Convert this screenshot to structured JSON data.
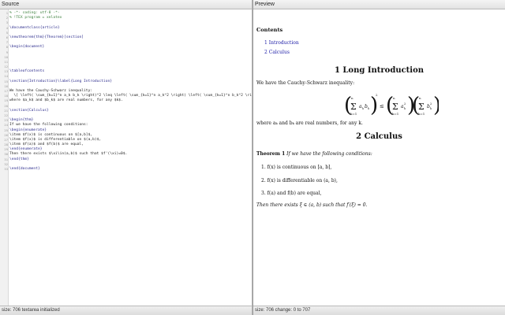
{
  "left": {
    "header": "Source",
    "status": "size: 706 textarea initialized",
    "lines": [
      {
        "n": "1",
        "text": "% -*- coding: utf-8 -*-",
        "cls": "comment"
      },
      {
        "n": "2",
        "text": "% !TEX program = xelatex",
        "cls": "comment"
      },
      {
        "n": "3",
        "text": "",
        "cls": "plain"
      },
      {
        "n": "4",
        "text": "\\documentclass{article}",
        "cls": "cmd"
      },
      {
        "n": "5",
        "text": "",
        "cls": "plain"
      },
      {
        "n": "6",
        "text": "\\newtheorem{thm}{Theorem}[section]",
        "cls": "cmd"
      },
      {
        "n": "7",
        "text": "",
        "cls": "plain"
      },
      {
        "n": "8",
        "text": "\\begin{document}",
        "cls": "cmd"
      },
      {
        "n": "9",
        "text": "",
        "cls": "plain"
      },
      {
        "n": "10",
        "text": "",
        "cls": "plain"
      },
      {
        "n": "11",
        "text": "",
        "cls": "plain"
      },
      {
        "n": "12",
        "text": "",
        "cls": "plain"
      },
      {
        "n": "13",
        "text": "\\tableofcontents",
        "cls": "cmd"
      },
      {
        "n": "14",
        "text": "",
        "cls": "plain"
      },
      {
        "n": "15",
        "text": "\\section{Introduction}\\label{Long Introduction}",
        "cls": "cmd"
      },
      {
        "n": "16",
        "text": "",
        "cls": "plain"
      },
      {
        "n": "17",
        "text": "We have the Cauchy-Schwarz inequality:",
        "cls": "plain"
      },
      {
        "n": "18",
        "text": "  \\[ \\left( \\sum_{k=1}^n a_k b_k \\right)^2 \\leq \\left( \\sum_{k=1}^n a_k^2 \\right) \\left( \\sum_{k=1}^n b_k^2 \\right) \\]",
        "cls": "plain"
      },
      {
        "n": "19",
        "text": "where $a_k$ and $b_k$ are real numbers, for any $k$.",
        "cls": "plain"
      },
      {
        "n": "20",
        "text": "",
        "cls": "plain"
      },
      {
        "n": "21",
        "text": "\\section{Calculus}",
        "cls": "cmd"
      },
      {
        "n": "22",
        "text": "",
        "cls": "plain"
      },
      {
        "n": "23",
        "text": "\\begin{thm}",
        "cls": "cmd"
      },
      {
        "n": "24",
        "text": "If we have the following conditions:",
        "cls": "plain"
      },
      {
        "n": "25",
        "text": "\\begin{enumerate}",
        "cls": "cmd"
      },
      {
        "n": "26",
        "text": "\\item $f(x)$ is continuous on $[a,b]$,",
        "cls": "plain"
      },
      {
        "n": "27",
        "text": "\\item $f(x)$ is differentiable on $(a,b)$,",
        "cls": "plain"
      },
      {
        "n": "28",
        "text": "\\item $f(a)$ and $f(b)$ are equal,",
        "cls": "plain"
      },
      {
        "n": "29",
        "text": "\\end{enumerate}",
        "cls": "cmd"
      },
      {
        "n": "30",
        "text": "Then there exists $\\xi\\in(a,b)$ such that $f'(\\xi)=0$.",
        "cls": "plain"
      },
      {
        "n": "31",
        "text": "\\end{thm}",
        "cls": "cmd"
      },
      {
        "n": "32",
        "text": "",
        "cls": "plain"
      },
      {
        "n": "33",
        "text": "\\end{document}",
        "cls": "cmd"
      }
    ]
  },
  "right": {
    "header": "Preview",
    "status": "size: 706 change: 0 to 707",
    "contents_title": "Contents",
    "toc": [
      "1 Introduction",
      "2 Calculus"
    ],
    "sec1_title": "1 Long Introduction",
    "sec1_intro": "We have the Cauchy-Schwarz inequality:",
    "sec1_where": "where aₖ and bₖ are real numbers, for any k.",
    "sec2_title": "2 Calculus",
    "thm_label": "Theorem 1",
    "thm_text": "If we have the following conditions:",
    "items": [
      "1. f(x) is continuous on [a, b],",
      "2. f(x) is differentiable on (a, b),",
      "3. f(a) and f(b) are equal,"
    ],
    "thm_conclusion": "Then there exists ξ ∈ (a, b) such that f′(ξ) = 0."
  }
}
